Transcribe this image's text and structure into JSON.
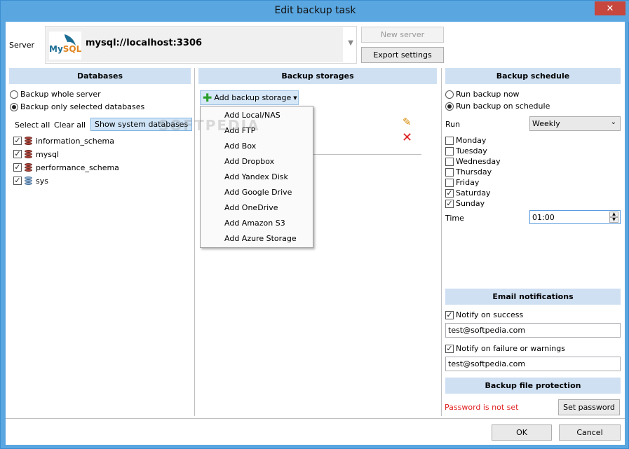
{
  "window": {
    "title": "Edit backup task",
    "close_label": "✕"
  },
  "server": {
    "label": "Server",
    "url": "mysql://localhost:3306",
    "logo_my": "My",
    "logo_sql": "SQL",
    "new_server_label": "New server",
    "export_settings_label": "Export settings"
  },
  "databases": {
    "header": "Databases",
    "option_whole": "Backup whole server",
    "option_selected": "Backup only selected databases",
    "select_all": "Select all",
    "clear_all": "Clear all",
    "show_system": "Show system databases",
    "items": [
      {
        "name": "information_schema",
        "checked": true
      },
      {
        "name": "mysql",
        "checked": true
      },
      {
        "name": "performance_schema",
        "checked": true
      },
      {
        "name": "sys",
        "checked": true
      }
    ]
  },
  "storages": {
    "header": "Backup storages",
    "add_label": "Add backup storage",
    "menu": [
      "Add Local/NAS",
      "Add FTP",
      "Add Box",
      "Add Dropbox",
      "Add Yandex Disk",
      "Add Google Drive",
      "Add OneDrive",
      "Add Amazon S3",
      "Add Azure Storage"
    ]
  },
  "schedule": {
    "header": "Backup schedule",
    "option_now": "Run backup now",
    "option_schedule": "Run backup on schedule",
    "run_label": "Run",
    "run_value": "Weekly",
    "days": [
      {
        "name": "Monday",
        "checked": false
      },
      {
        "name": "Tuesday",
        "checked": false
      },
      {
        "name": "Wednesday",
        "checked": false
      },
      {
        "name": "Thursday",
        "checked": false
      },
      {
        "name": "Friday",
        "checked": false
      },
      {
        "name": "Saturday",
        "checked": true
      },
      {
        "name": "Sunday",
        "checked": true
      }
    ],
    "time_label": "Time",
    "time_value": "01:00"
  },
  "email": {
    "header": "Email notifications",
    "notify_success": "Notify on success",
    "success_email": "test@softpedia.com",
    "notify_failure": "Notify on failure or warnings",
    "failure_email": "test@softpedia.com"
  },
  "protection": {
    "header": "Backup file protection",
    "status": "Password is not set",
    "status_color": "#e02020",
    "set_password": "Set password"
  },
  "footer": {
    "ok": "OK",
    "cancel": "Cancel"
  },
  "watermark": "SOFTPEDIA"
}
